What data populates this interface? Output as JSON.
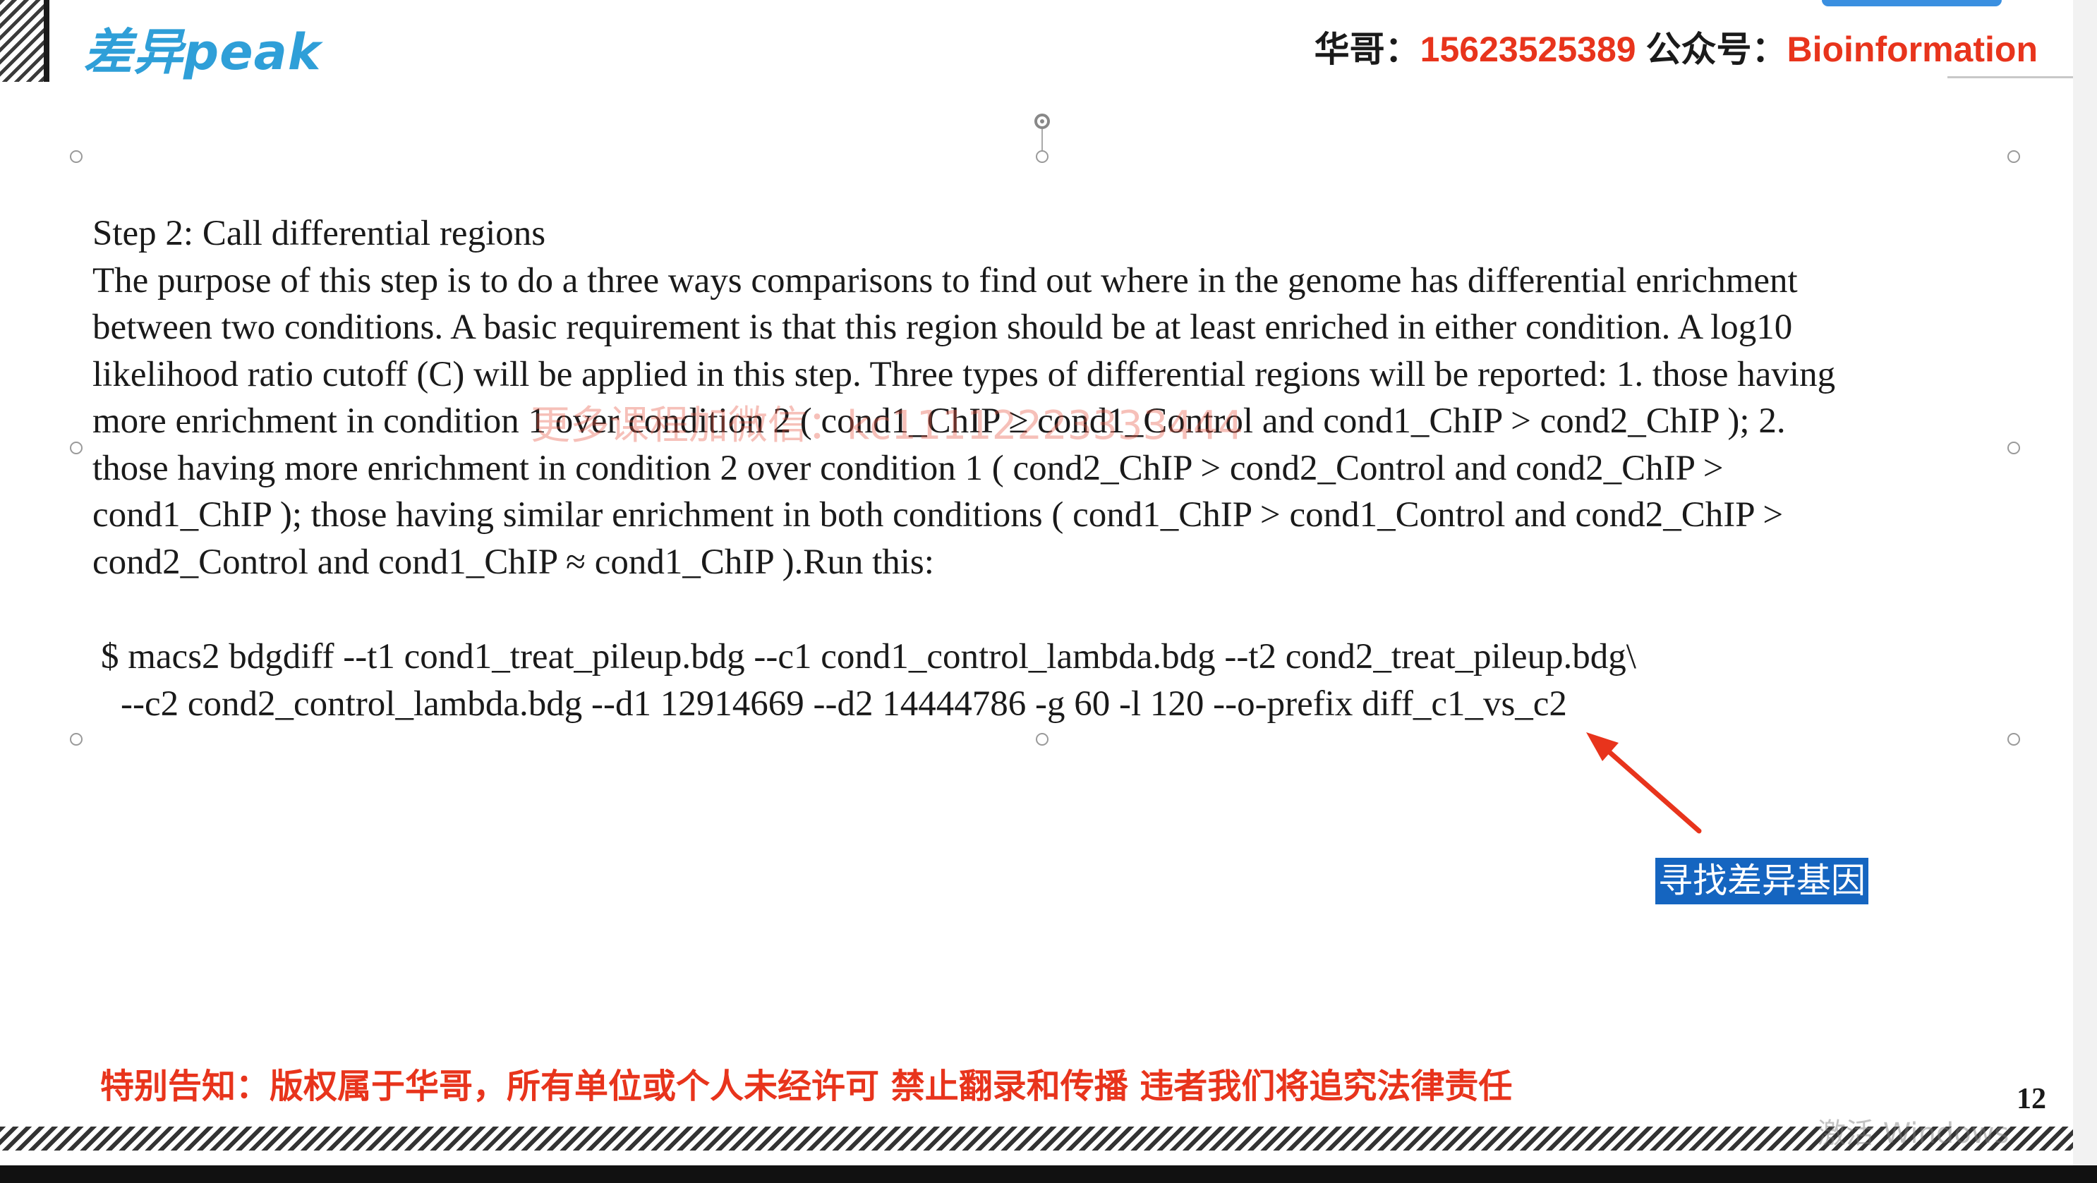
{
  "header": {
    "title": "差异peak",
    "contact_name_label": "华哥：",
    "phone": "15623525389",
    "account_label": "公众号：",
    "account": "Bioinformation"
  },
  "content": {
    "heading": "Step 2: Call differential regions",
    "lines": [
      "The purpose of this step is to do a three ways comparisons to find out where in the genome has differential enrichment",
      "between two conditions. A basic requirement is that this region should be at least enriched in either condition. A log10",
      "likelihood ratio cutoff (C) will be applied in this step. Three types of differential regions will be reported: 1. those having",
      "more enrichment in condition 1 over condition 2 ( cond1_ChIP ≥ cond1_Control and cond1_ChIP > cond2_ChIP ); 2.",
      "those having more enrichment in condition 2 over condition 1 ( cond2_ChIP > cond2_Control and cond2_ChIP >",
      "cond1_ChIP ); those having similar enrichment in both conditions ( cond1_ChIP > cond1_Control and cond2_ChIP >",
      "cond2_Control and cond1_ChIP ≈ cond1_ChIP ).Run this:"
    ],
    "command_line1": "$ macs2 bdgdiff --t1 cond1_treat_pileup.bdg --c1 cond1_control_lambda.bdg --t2 cond2_treat_pileup.bdg\\",
    "command_line2": "--c2 cond2_control_lambda.bdg --d1 12914669 --d2 14444786 -g 60 -l 120 --o-prefix diff_c1_vs_c2"
  },
  "watermark": "更多课程加微信：kc11112223333444",
  "callout": "寻找差异基因",
  "notice": "特别告知：版权属于华哥，所有单位或个人未经许可 禁止翻录和传播 违者我们将追究法律责任",
  "page_number": "12",
  "system_hint": "激活 Windows",
  "colors": {
    "title": "#2f9fd8",
    "accent_red": "#e8341c",
    "callout_bg": "#1565c0"
  },
  "icons": [
    "rotate-handle-icon",
    "selection-handle-icon",
    "red-arrow-icon"
  ]
}
